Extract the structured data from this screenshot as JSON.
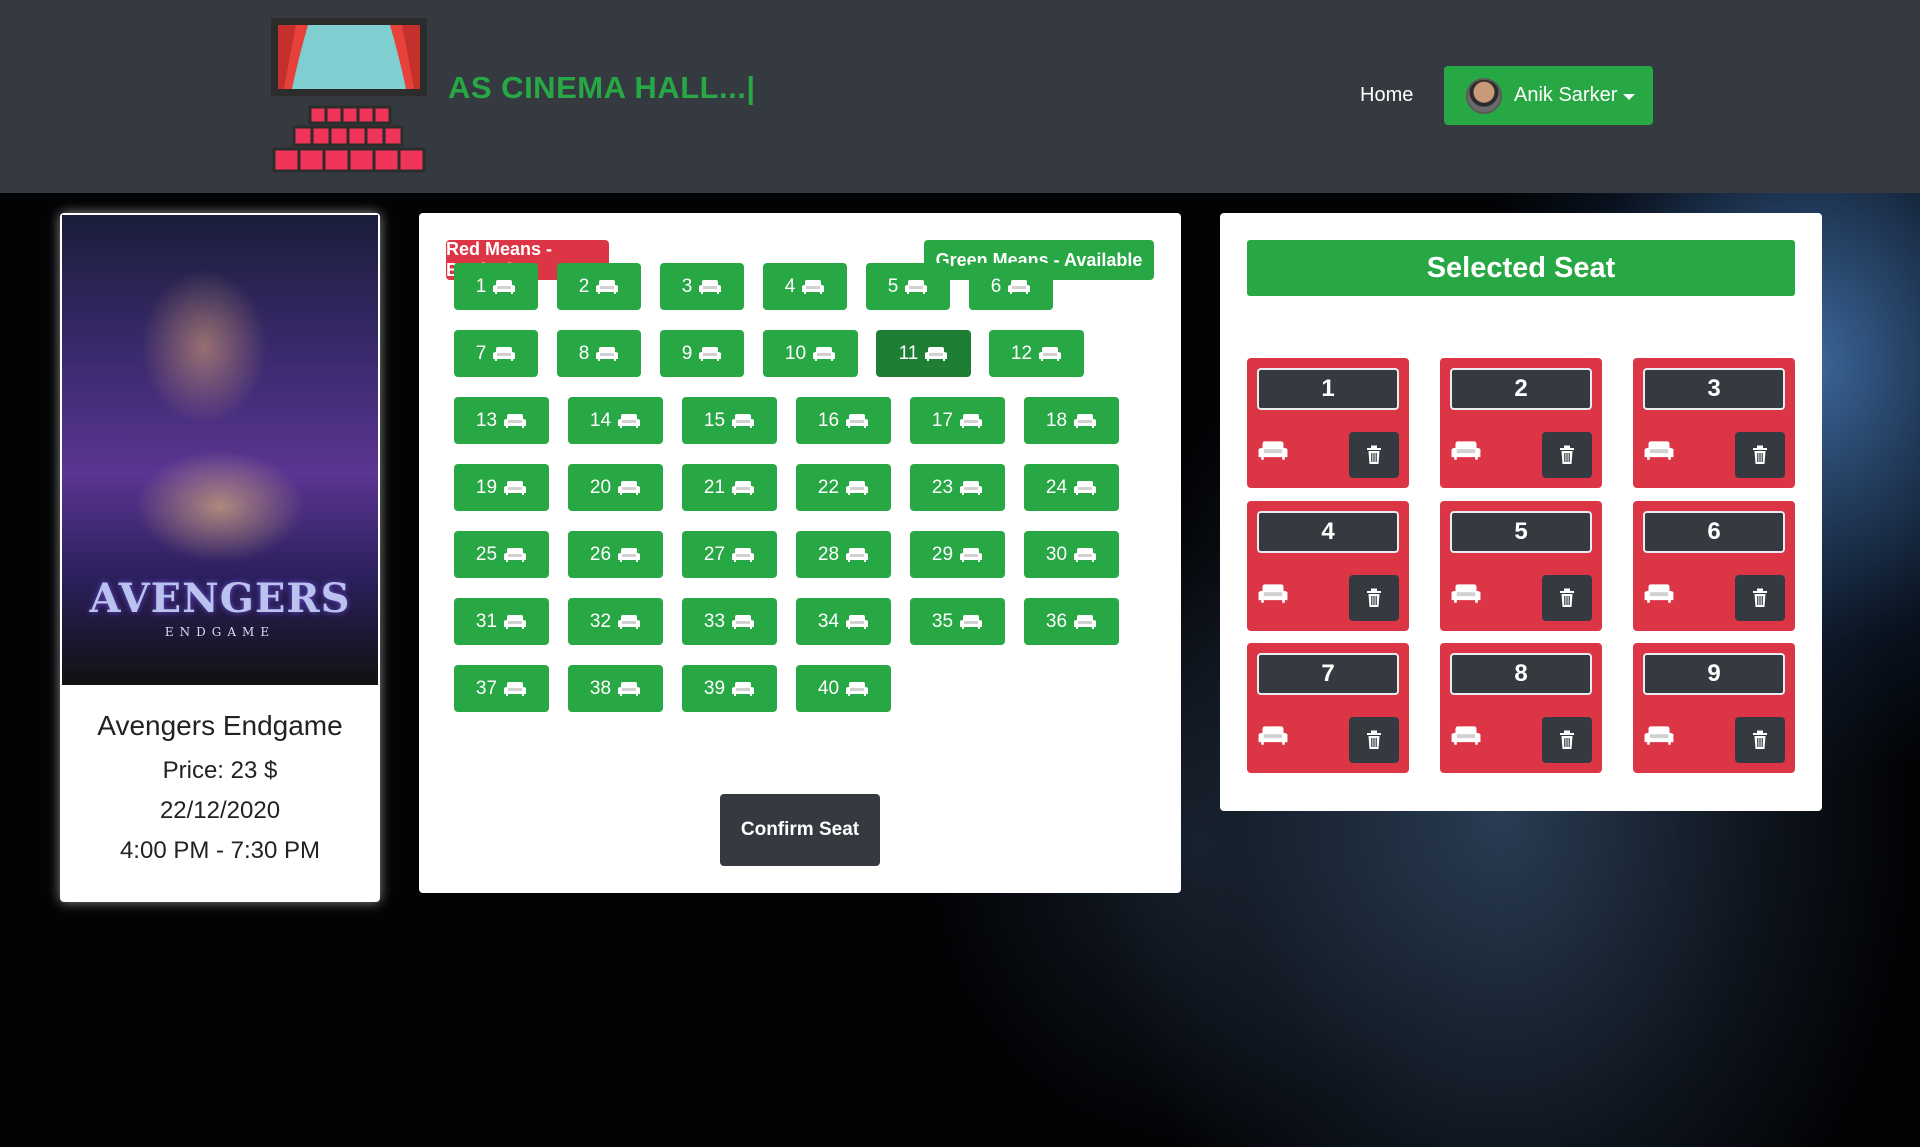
{
  "navbar": {
    "brand": "AS CINEMA HALL...|",
    "home_label": "Home",
    "user_name": "Anik Sarker"
  },
  "movie": {
    "poster_title": "AVENGERS",
    "poster_subtitle": "ENDGAME",
    "name": "Avengers Endgame",
    "price": "Price: 23 $",
    "date": "22/12/2020",
    "time": "4:00 PM - 7:30 PM"
  },
  "legend": {
    "booked": "Red Means - Booked",
    "available": "Green Means - Available"
  },
  "seats": [
    "1",
    "2",
    "3",
    "4",
    "5",
    "6",
    "7",
    "8",
    "9",
    "10",
    "11",
    "12",
    "13",
    "14",
    "15",
    "16",
    "17",
    "18",
    "19",
    "20",
    "21",
    "22",
    "23",
    "24",
    "25",
    "26",
    "27",
    "28",
    "29",
    "30",
    "31",
    "32",
    "33",
    "34",
    "35",
    "36",
    "37",
    "38",
    "39",
    "40"
  ],
  "active_seat": "11",
  "confirm_label": "Confirm Seat",
  "selected": {
    "title": "Selected Seat",
    "seats": [
      "1",
      "2",
      "3",
      "4",
      "5",
      "6",
      "7",
      "8",
      "9"
    ]
  },
  "colors": {
    "navbar": "#343a40",
    "success": "#28a745",
    "success_active": "#1e7e34",
    "danger": "#dc3545",
    "dark": "#343a40"
  },
  "icons": {
    "seat_icon": "couch-icon",
    "delete_icon": "trash-icon",
    "logo": "cinema-logo-icon"
  }
}
